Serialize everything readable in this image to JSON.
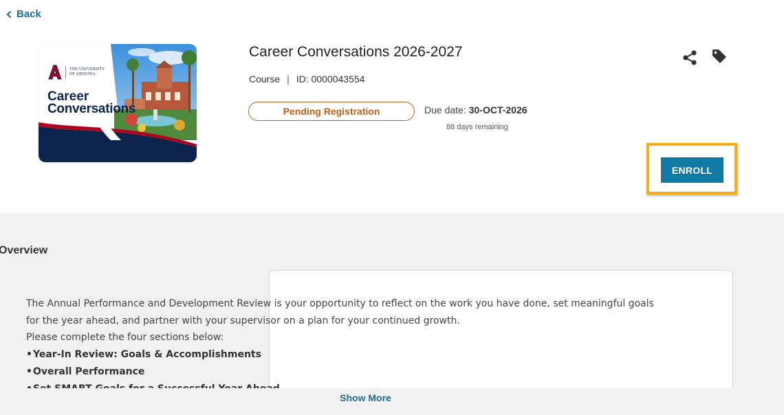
{
  "nav": {
    "back_label": "Back"
  },
  "thumbnail": {
    "university_line1": "THE UNIVERSITY",
    "university_line2": "OF ARIZONA",
    "title_line1": "Career",
    "title_line2": "Conversations"
  },
  "course": {
    "title": "Career Conversations 2026-2027",
    "type": "Course",
    "separator": "|",
    "id_text": "ID: 0000043554",
    "status": "Pending Registration",
    "due_label": "Due date:",
    "due_date": "30-OCT-2026",
    "remaining": "88 days remaining"
  },
  "actions": {
    "enroll_label": "ENROLL",
    "share_icon": "share-icon",
    "tag_icon": "tag-icon"
  },
  "overview": {
    "heading": "Overview",
    "paragraph1": "The Annual Performance and Development Review is your opportunity to reflect on the work you have done, set meaningful goals",
    "paragraph2": "for the year ahead, and partner with your supervisor on a plan for your continued growth.",
    "paragraph3": "Please complete the four sections below:",
    "items": [
      "Year-In Review: Goals & Accomplishments",
      "Overall Performance",
      "Set SMART Goals for a Successful Year Ahead"
    ],
    "show_more_label": "Show More"
  },
  "colors": {
    "accent": "#0f7aa4",
    "link": "#1d6c9a",
    "status": "#b9611a",
    "highlight": "#f2ad17",
    "section_bg": "#f1f1f1"
  }
}
